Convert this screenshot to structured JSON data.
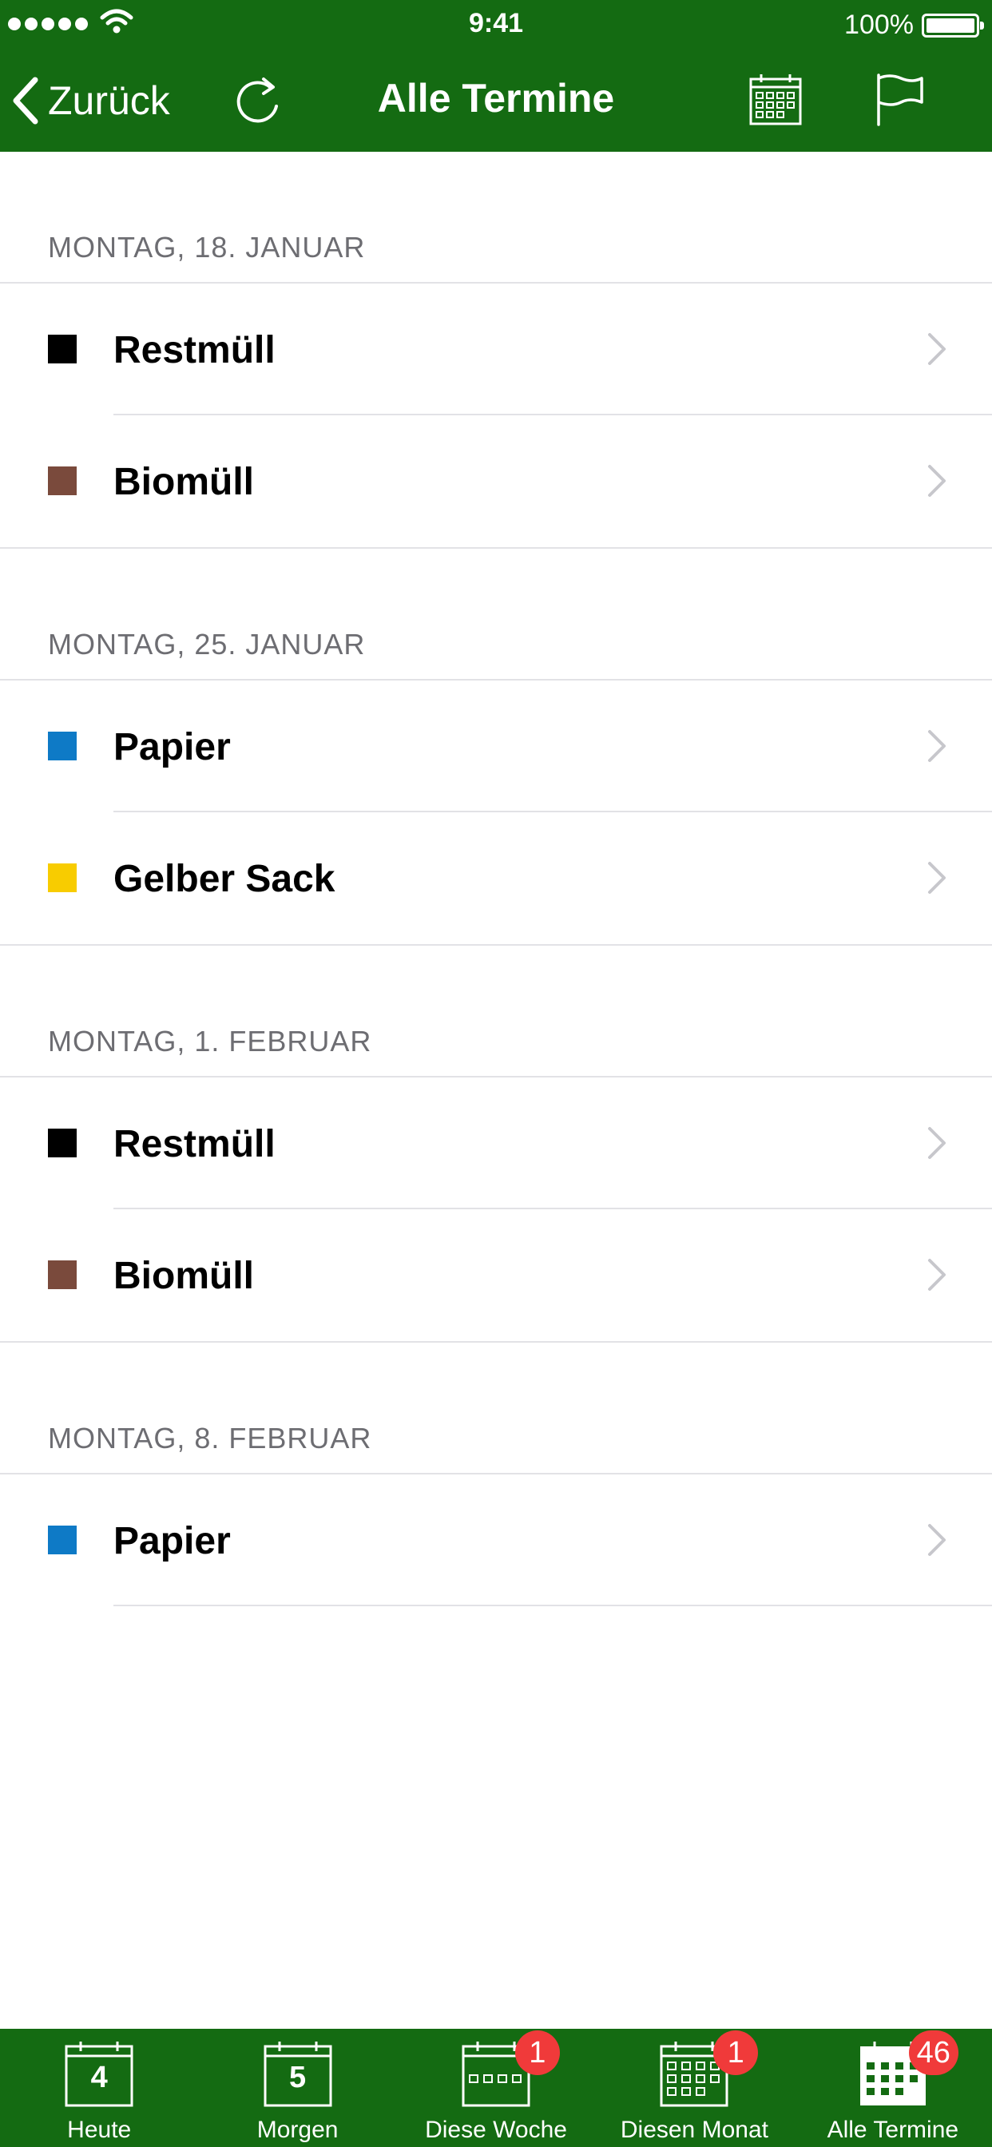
{
  "status_bar": {
    "time": "9:41",
    "battery": "100%"
  },
  "nav": {
    "back_label": "Zurück",
    "title": "Alle Termine"
  },
  "sections": [
    {
      "date": "MONTAG, 18. JANUAR",
      "items": [
        {
          "label": "Restmüll",
          "color": "#000000"
        },
        {
          "label": "Biomüll",
          "color": "#7a4a3c"
        }
      ]
    },
    {
      "date": "MONTAG, 25. JANUAR",
      "items": [
        {
          "label": "Papier",
          "color": "#0e7ac6"
        },
        {
          "label": "Gelber Sack",
          "color": "#f8cc00"
        }
      ]
    },
    {
      "date": "MONTAG, 1. FEBRUAR",
      "items": [
        {
          "label": "Restmüll",
          "color": "#000000"
        },
        {
          "label": "Biomüll",
          "color": "#7a4a3c"
        }
      ]
    },
    {
      "date": "MONTAG, 8. FEBRUAR",
      "items": [
        {
          "label": "Papier",
          "color": "#0e7ac6"
        }
      ]
    }
  ],
  "tabs": [
    {
      "label": "Heute",
      "day": "4",
      "badge": ""
    },
    {
      "label": "Morgen",
      "day": "5",
      "badge": ""
    },
    {
      "label": "Diese Woche",
      "badge": "1"
    },
    {
      "label": "Diesen Monat",
      "badge": "1"
    },
    {
      "label": "Alle Termine",
      "badge": "46"
    }
  ],
  "colors": {
    "primary": "#146b12",
    "badge": "#f03a3a",
    "separator": "#e2e2e6",
    "section_text": "#6d6d72"
  }
}
